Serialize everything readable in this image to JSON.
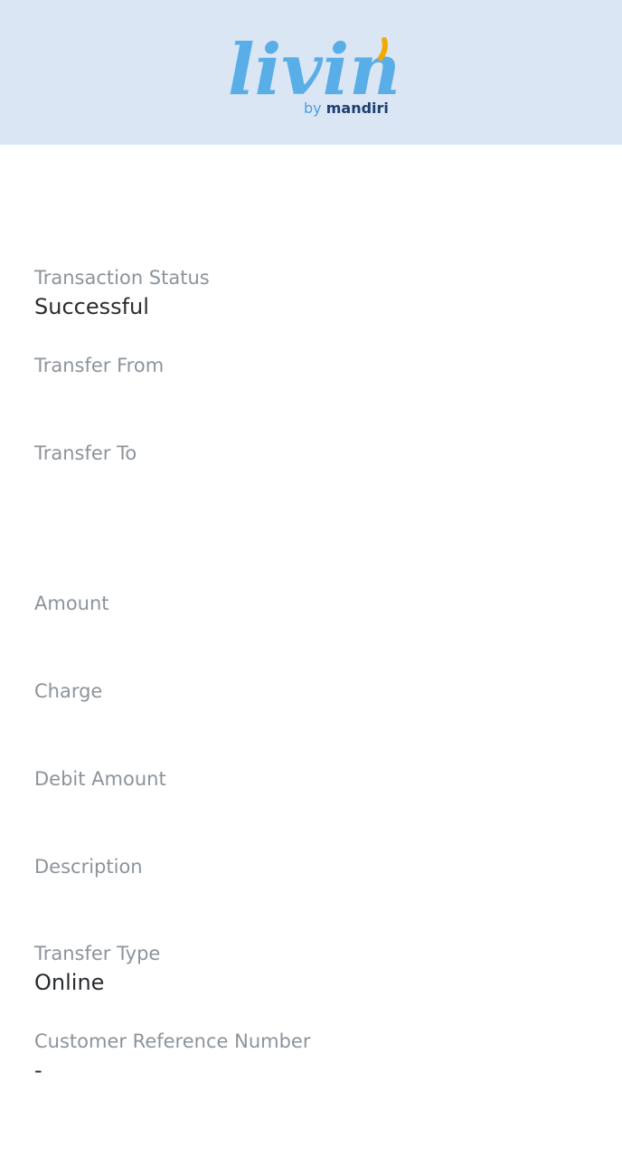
{
  "header": {
    "logo_script": "livin",
    "logo_by": "by",
    "logo_brand": "mandiri",
    "colors": {
      "background": "#dae6f3",
      "script": "#5aaee8",
      "accent": "#f2a900",
      "brand": "#1d3f72"
    }
  },
  "details": [
    {
      "label": "Transaction Status",
      "value": "Successful"
    },
    {
      "label": "Transfer From",
      "value": ""
    },
    {
      "label": "Transfer To",
      "value": ""
    },
    {
      "label": "Amount",
      "value": ""
    },
    {
      "label": "Charge",
      "value": ""
    },
    {
      "label": "Debit Amount",
      "value": ""
    },
    {
      "label": "Description",
      "value": ""
    },
    {
      "label": "Transfer Type",
      "value": "Online"
    },
    {
      "label": "Customer Reference Number",
      "value": "-"
    }
  ]
}
